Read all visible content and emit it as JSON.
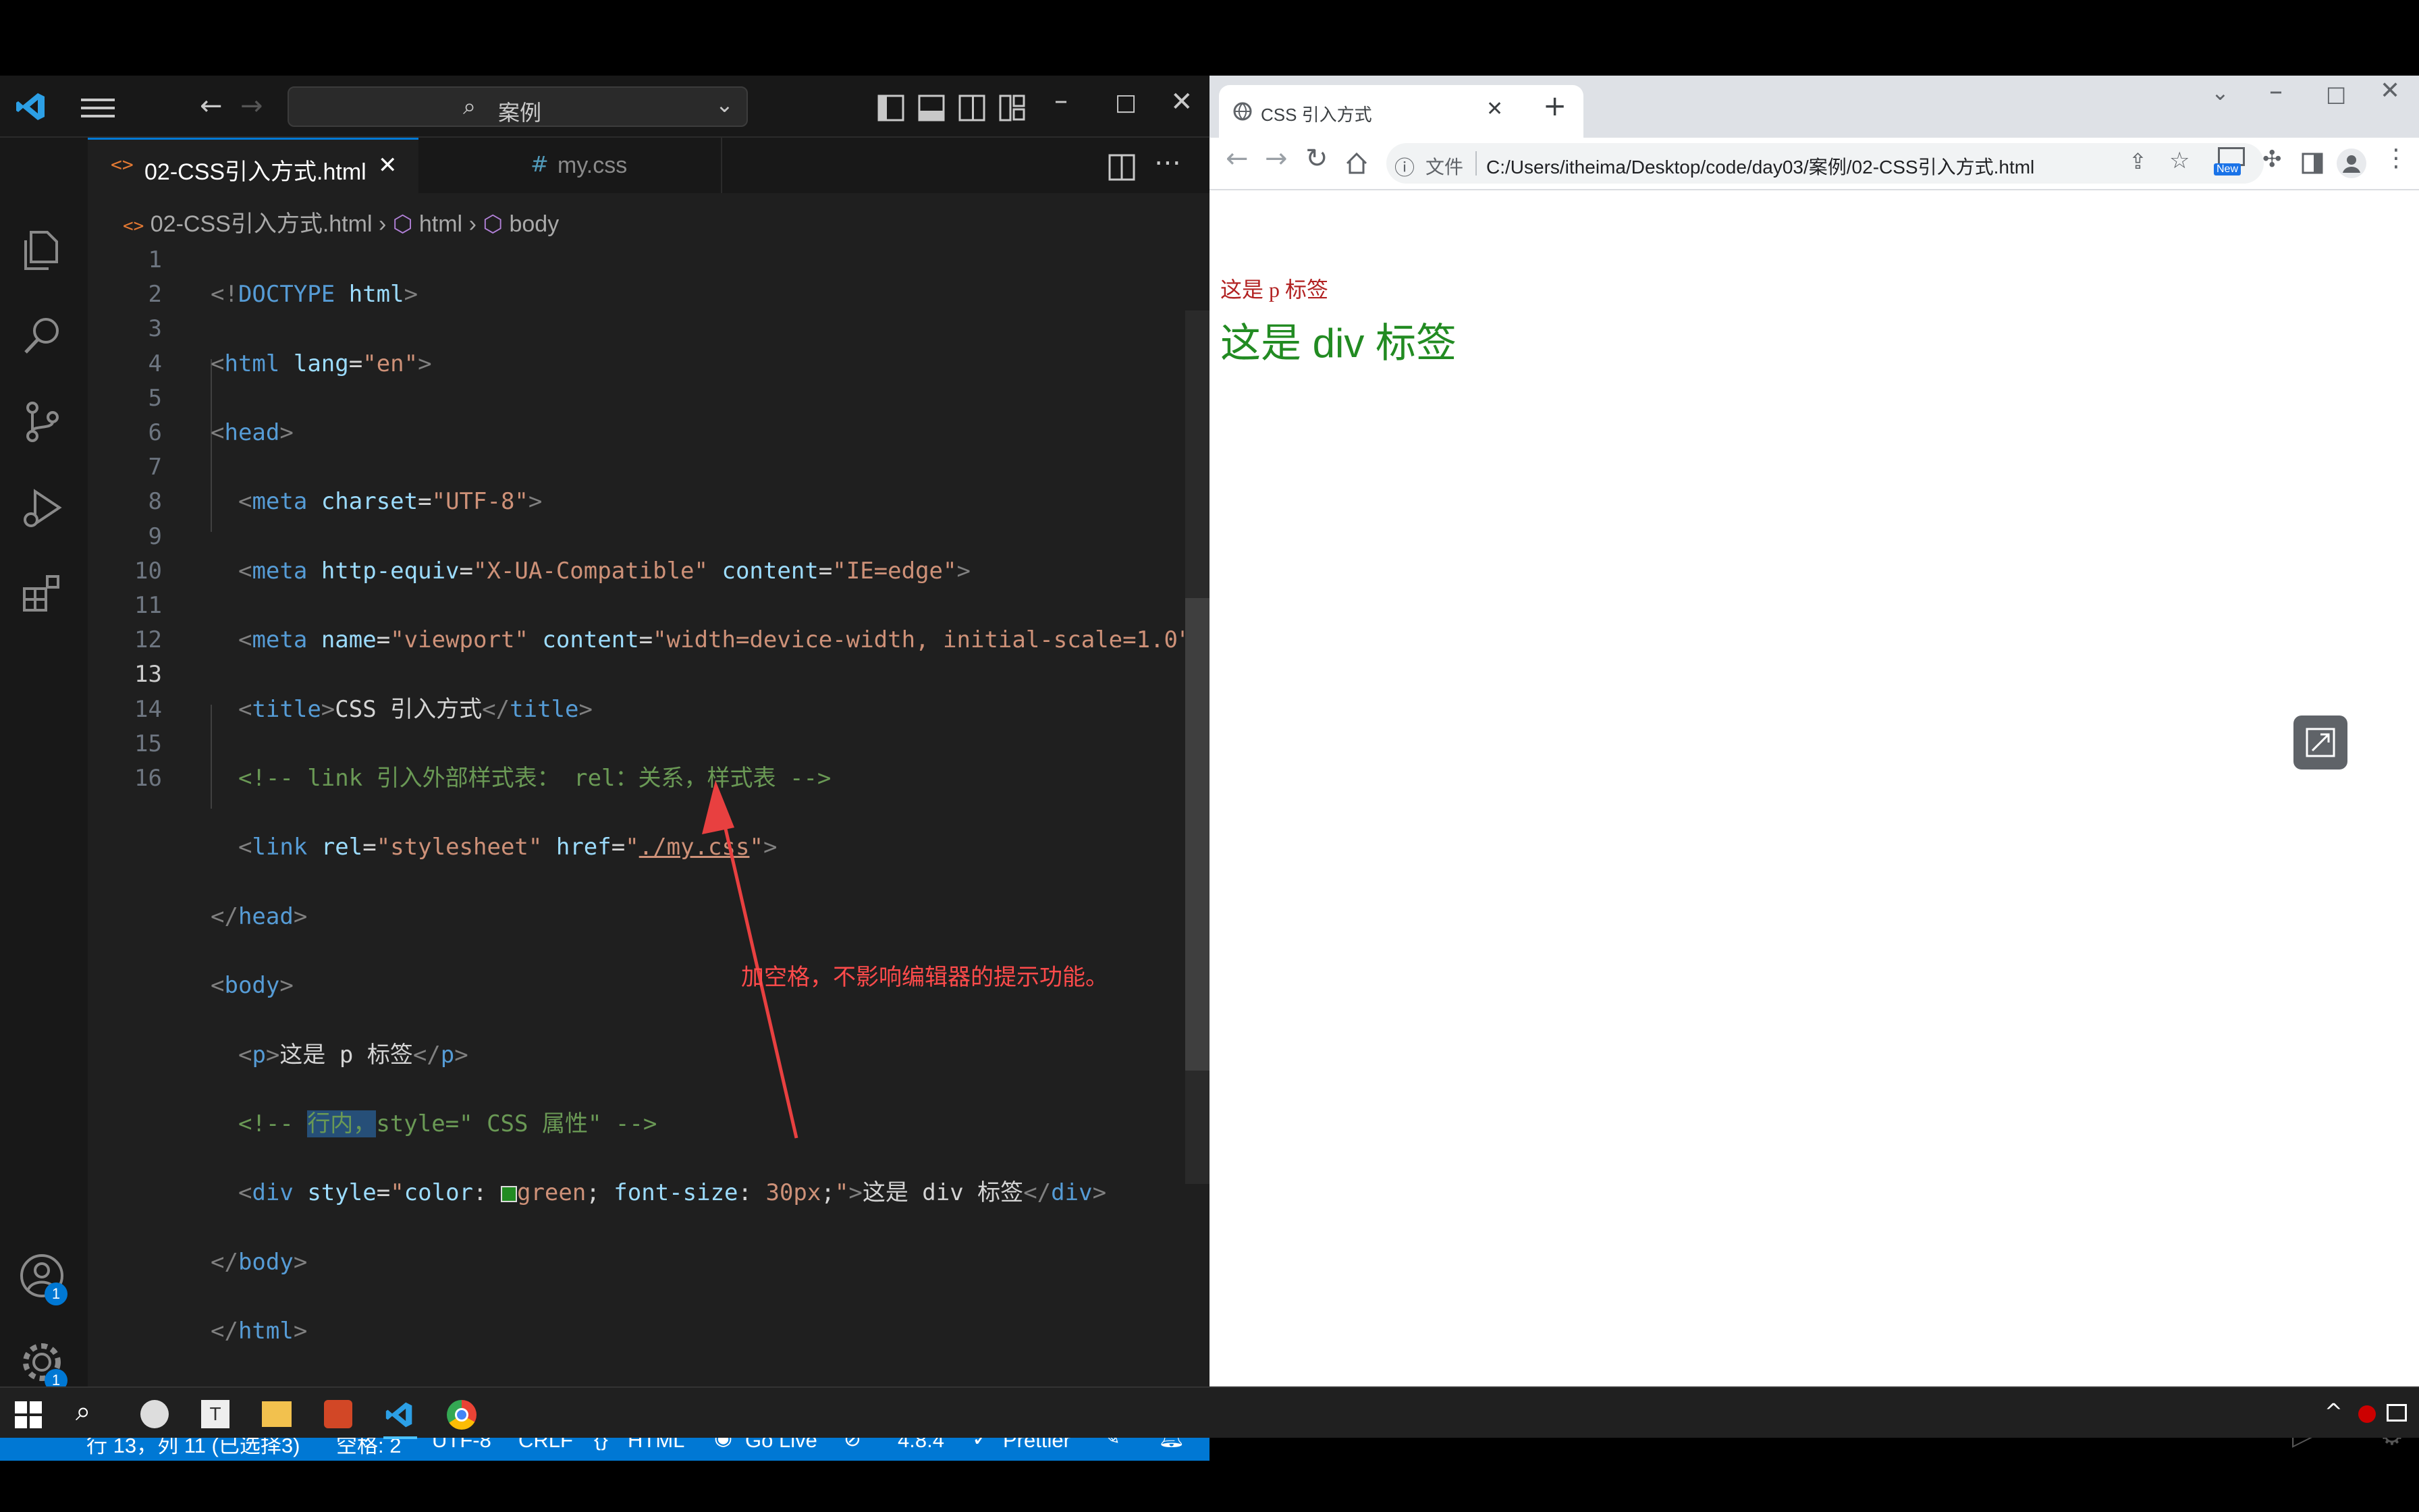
{
  "vscode": {
    "search_text": "案例",
    "tabs": [
      {
        "label": "02-CSS引入方式.html",
        "close": "✕"
      },
      {
        "label": "my.css",
        "icon": "#"
      }
    ],
    "breadcrumb": {
      "file": "02-CSS引入方式.html",
      "html": "html",
      "body": "body"
    },
    "line_numbers": [
      "1",
      "2",
      "3",
      "4",
      "5",
      "6",
      "7",
      "8",
      "9",
      "10",
      "11",
      "12",
      "13",
      "14",
      "15",
      "16"
    ],
    "accounts_badge": "1",
    "settings_badge": "1",
    "annotation": "加空格，不影响编辑器的提示功能。",
    "status": {
      "position": "行 13，列 11 (已选择3)",
      "spaces": "空格: 2",
      "encoding": "UTF-8",
      "eol": "CRLF",
      "language": "HTML",
      "golive": "Go Live",
      "version": "4.8.4",
      "prettier": "Prettier"
    }
  },
  "chrome": {
    "tab_title": "CSS 引入方式",
    "tab_close": "✕",
    "new_tab": "+",
    "url_label": "文件",
    "url": "C:/Users/itheima/Desktop/code/day03/案例/02-CSS引入方式.html",
    "new_badge": "New",
    "p_text": "这是 p 标签",
    "div_text": "这是 div 标签"
  },
  "colors": {
    "p_text": "#b22222",
    "div_text": "#228b22",
    "accent": "#0078d4"
  }
}
